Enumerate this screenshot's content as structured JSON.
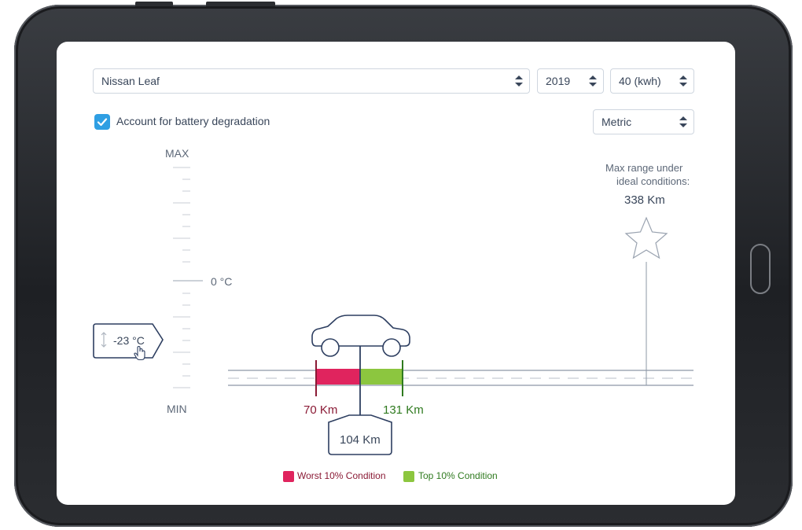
{
  "vehicle": {
    "model": "Nissan Leaf",
    "year": "2019",
    "battery": "40 (kwh)"
  },
  "options": {
    "degradation_label": "Account for battery degradation",
    "units": "Metric"
  },
  "scale": {
    "max_label": "MAX",
    "min_label": "MIN",
    "zero_label": "0 °C",
    "temperature": "-23 °C"
  },
  "ideal": {
    "label_line1": "Max range under",
    "label_line2": "ideal conditions:",
    "value": "338 Km"
  },
  "range": {
    "worst": "70 Km",
    "best": "131 Km",
    "estimate": "104 Km"
  },
  "legend": {
    "worst_label": "Worst 10% Condition",
    "top_label": "Top 10% Condition"
  },
  "colors": {
    "worst": "#e0245e",
    "top": "#8cc63f",
    "accent": "#2f9fe3",
    "line": "#2d3e60"
  }
}
